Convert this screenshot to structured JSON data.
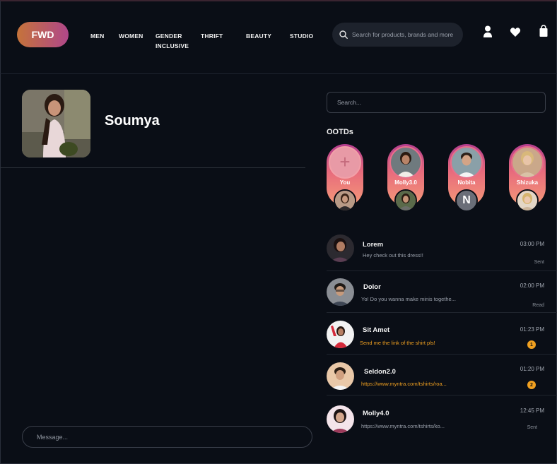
{
  "header": {
    "logo": "FWD",
    "nav": [
      "MEN",
      "WOMEN",
      "GENDER",
      "INCLUSIVE",
      "THRIFT",
      "BEAUTY",
      "STUDIO"
    ],
    "search_placeholder": "Search for products, brands and more",
    "icons": [
      "user-icon",
      "heart-icon",
      "shopping-bag-icon"
    ]
  },
  "profile": {
    "name": "Soumya",
    "message_placeholder": "Message..."
  },
  "sidebar": {
    "search_placeholder": "Search...",
    "ootd_title": "OOTDs",
    "stories": [
      {
        "label": "You",
        "add_symbol": "+"
      },
      {
        "label": "Molly3.0"
      },
      {
        "label": "Nobita",
        "initial": "N"
      },
      {
        "label": "Shizuka"
      }
    ],
    "chats": [
      {
        "name": "Lorem",
        "message": "Hey check out this dress!!",
        "time": "03:00 PM",
        "status": "Sent",
        "unread": false
      },
      {
        "name": "Dolor",
        "message": "Yo! Do you wanna make minis togethe...",
        "time": "02:00 PM",
        "status": "Read",
        "unread": false
      },
      {
        "name": "Sit Amet",
        "message": "Send me the link of the shirt pls!",
        "time": "01:23 PM",
        "badge": "1",
        "unread": true
      },
      {
        "name": "Seldon2.0",
        "message": "https://www.myntra.com/tshirts/roa...",
        "time": "01:20 PM",
        "badge": "2",
        "unread": true
      },
      {
        "name": "Molly4.0",
        "message": "https://www.myntra.com/tshirts/ko...",
        "time": "12:45 PM",
        "status": "Sent",
        "unread": false
      }
    ]
  },
  "colors": {
    "background": "#0a0e16",
    "logo_gradient_start": "#c5733a",
    "logo_gradient_end": "#b0478a",
    "unread": "#f0a020",
    "story_gradient_top": "#b33d8e",
    "story_gradient_bottom": "#f49a78"
  }
}
